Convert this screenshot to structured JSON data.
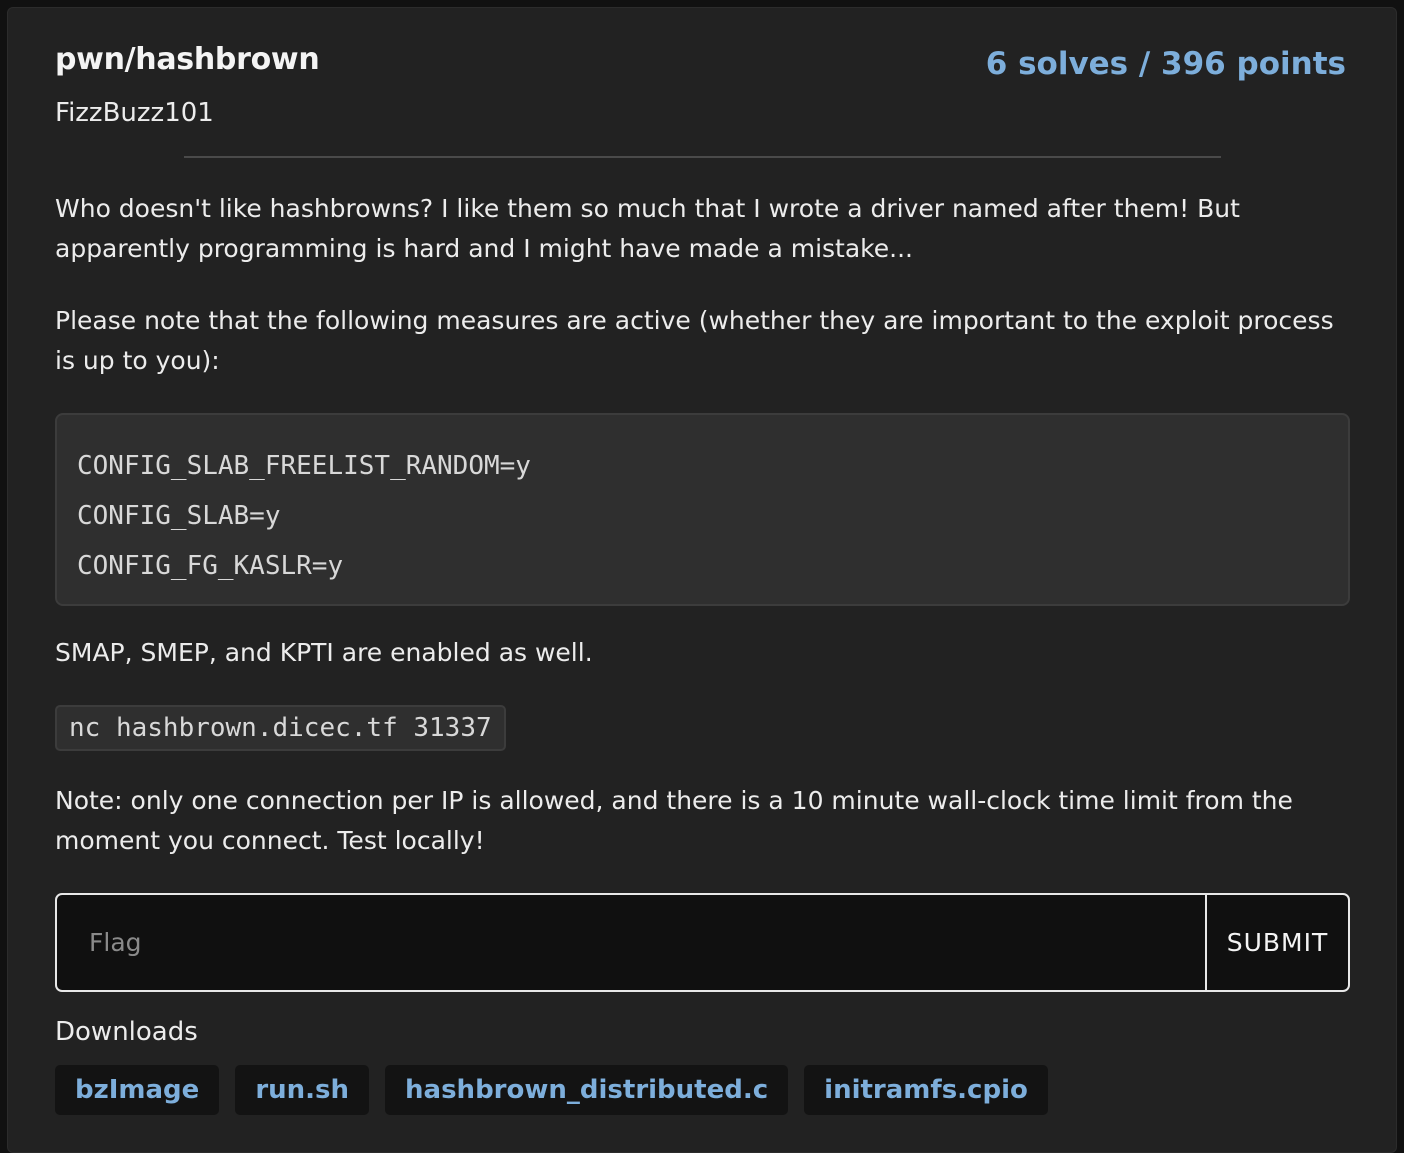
{
  "challenge": {
    "title": "pwn/hashbrown",
    "score": "6 solves / 396 points",
    "author": "FizzBuzz101"
  },
  "description": {
    "p1": "Who doesn't like hashbrowns? I like them so much that I wrote a driver named after them! But apparently programming is hard and I might have made a mistake...",
    "p2": "Please note that the following measures are active (whether they are important to the exploit process is up to you):",
    "config_lines": [
      "CONFIG_SLAB_FREELIST_RANDOM=y",
      "CONFIG_SLAB=y",
      "CONFIG_FG_KASLR=y"
    ],
    "p3": "SMAP, SMEP, and KPTI are enabled as well.",
    "connect_command": "nc hashbrown.dicec.tf 31337",
    "p4": "Note: only one connection per IP is allowed, and there is a 10 minute wall-clock time limit from the moment you connect. Test locally!"
  },
  "flag_form": {
    "placeholder": "Flag",
    "submit_label": "SUBMIT"
  },
  "downloads": {
    "label": "Downloads",
    "files": [
      "bzImage",
      "run.sh",
      "hashbrown_distributed.c",
      "initramfs.cpio"
    ]
  },
  "colors": {
    "accent": "#7daedb",
    "card_background": "#222222",
    "code_background": "#2f2f2f"
  }
}
